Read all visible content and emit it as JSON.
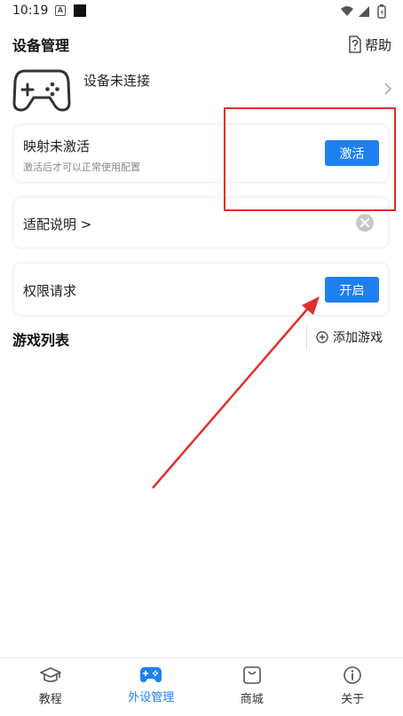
{
  "status_bar": {
    "time": "10:19"
  },
  "header": {
    "title": "设备管理",
    "help_label": "帮助"
  },
  "device": {
    "status_text": "设备未连接"
  },
  "activation_card": {
    "title": "映射未激活",
    "subtitle": "激活后才可以正常使用配置",
    "button_label": "激活"
  },
  "guide_card": {
    "title": "适配说明 >"
  },
  "permission_card": {
    "title": "权限请求",
    "button_label": "开启"
  },
  "game_list": {
    "title": "游戏列表",
    "add_label": "添加游戏"
  },
  "bottom_nav": {
    "items": [
      {
        "label": "教程",
        "icon": "graduation-cap-icon"
      },
      {
        "label": "外设管理",
        "icon": "gamepad-icon",
        "active": true
      },
      {
        "label": "商城",
        "icon": "shopping-bag-icon"
      },
      {
        "label": "关于",
        "icon": "info-icon"
      }
    ]
  },
  "colors": {
    "accent": "#1e80f0",
    "annotation": "#e0302b"
  }
}
